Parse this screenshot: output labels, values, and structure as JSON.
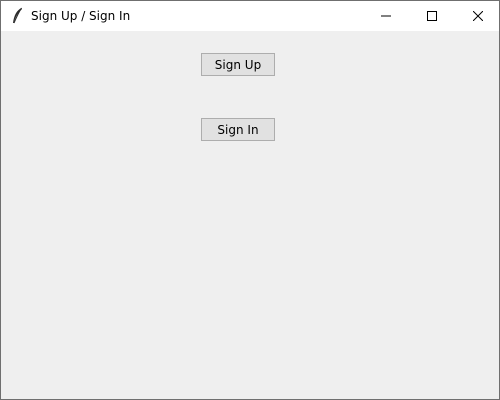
{
  "window": {
    "title": "Sign Up / Sign In",
    "icons": {
      "app": "feather-icon",
      "minimize": "minimize-icon",
      "maximize": "maximize-icon",
      "close": "close-icon"
    }
  },
  "buttons": {
    "signup_label": "Sign Up",
    "signin_label": "Sign In"
  },
  "colors": {
    "background": "#efefef",
    "titlebar": "#ffffff",
    "button_face": "#e1e1e1",
    "button_border": "#adadad"
  }
}
